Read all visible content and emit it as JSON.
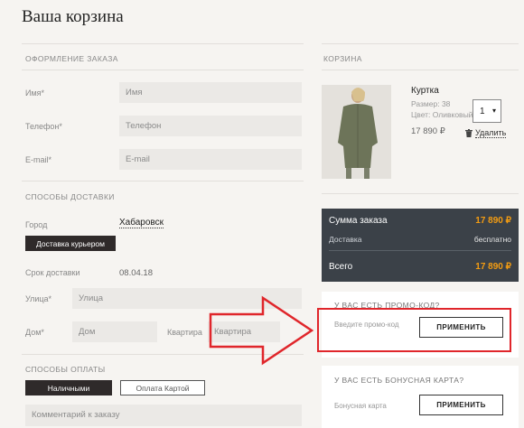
{
  "page": {
    "title": "Ваша корзина"
  },
  "checkout": {
    "section_order": "ОФОРМЛЕНИЕ ЗАКАЗА",
    "name_label": "Имя*",
    "name_placeholder": "Имя",
    "phone_label": "Телефон*",
    "phone_placeholder": "Телефон",
    "email_label": "E-mail*",
    "email_placeholder": "E-mail",
    "section_delivery": "СПОСОБЫ ДОСТАВКИ",
    "city_label": "Город",
    "city_value": "Хабаровск",
    "courier_button": "Доставка курьером",
    "delivery_date_label": "Срок доставки",
    "delivery_date_value": "08.04.18",
    "street_label": "Улица*",
    "street_placeholder": "Улица",
    "house_label": "Дом*",
    "house_placeholder": "Дом",
    "apartment_label": "Квартира",
    "apartment_placeholder": "Квартира",
    "section_payment": "СПОСОБЫ ОПЛАТЫ",
    "cash_button": "Наличными",
    "card_button": "Оплата Картой",
    "comment_placeholder": "Комментарий к заказу"
  },
  "cart": {
    "section_title": "КОРЗИНА",
    "item": {
      "name": "Куртка",
      "size": "Размер: 38",
      "color": "Цвет: Оливковый",
      "price": "17 890 ₽",
      "quantity": "1",
      "delete_label": "Удалить"
    },
    "summary": {
      "total_label": "Сумма заказа",
      "total_value": "17 890 ₽",
      "delivery_label": "Доставка",
      "delivery_value": "бесплатно",
      "grand_label": "Всего",
      "grand_value": "17 890 ₽"
    },
    "promo": {
      "title": "У ВАС ЕСТЬ ПРОМО-КОД?",
      "placeholder": "Введите промо-код",
      "apply": "ПРИМЕНИТЬ"
    },
    "bonus": {
      "title": "У ВАС ЕСТЬ БОНУСНАЯ КАРТА?",
      "placeholder": "Бонусная карта",
      "apply": "ПРИМЕНИТЬ"
    }
  },
  "colors": {
    "accent": "#f39c12",
    "summary_bg": "#3b4148",
    "annotation": "#e0262b"
  }
}
